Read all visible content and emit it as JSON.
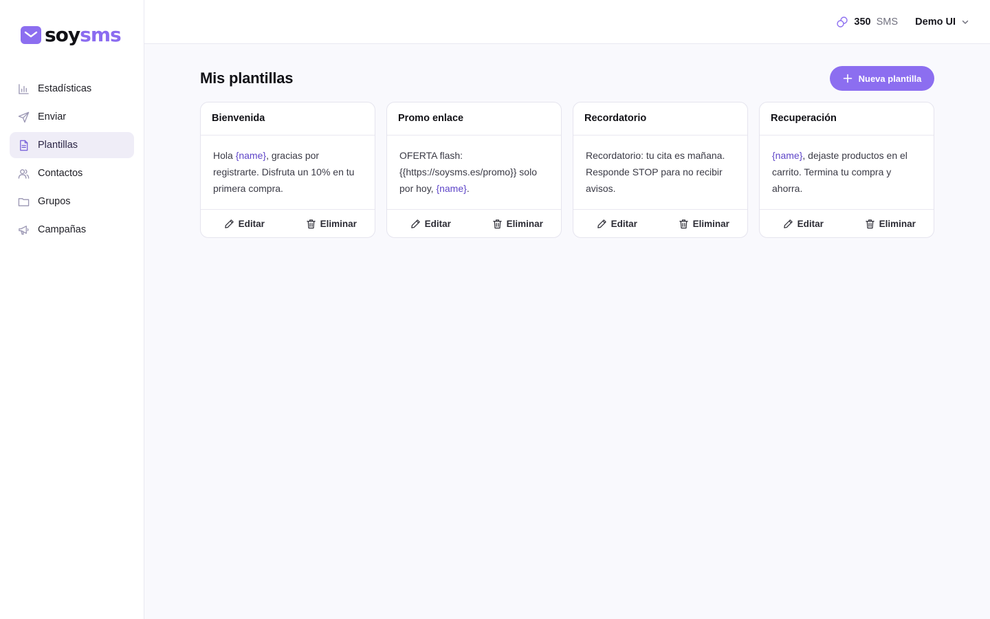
{
  "brand": {
    "name_part1": "soy",
    "name_part2": "sms",
    "accent": "#8c6ef0"
  },
  "sidebar": {
    "items": [
      {
        "label": "Estadísticas",
        "icon": "bar-chart-icon",
        "active": false
      },
      {
        "label": "Enviar",
        "icon": "send-icon",
        "active": false
      },
      {
        "label": "Plantillas",
        "icon": "document-icon",
        "active": true
      },
      {
        "label": "Contactos",
        "icon": "users-icon",
        "active": false
      },
      {
        "label": "Grupos",
        "icon": "folder-icon",
        "active": false
      },
      {
        "label": "Campañas",
        "icon": "megaphone-icon",
        "active": false
      }
    ]
  },
  "topbar": {
    "credits_icon": "coins-icon",
    "credits_count": "350",
    "credits_unit": "SMS",
    "user_name": "Demo UI"
  },
  "main": {
    "title": "Mis plantillas",
    "new_button_label": "Nueva plantilla"
  },
  "templates": [
    {
      "title": "Bienvenida",
      "body": [
        {
          "text": "Hola ",
          "var": false
        },
        {
          "text": "{name}",
          "var": true
        },
        {
          "text": ", gracias por registrarte. Disfruta un 10% en tu primera compra.",
          "var": false
        }
      ]
    },
    {
      "title": "Promo enlace",
      "body": [
        {
          "text": "OFERTA flash: {{https://soysms.es/promo}} solo por hoy, ",
          "var": false
        },
        {
          "text": "{name}",
          "var": true
        },
        {
          "text": ".",
          "var": false
        }
      ]
    },
    {
      "title": "Recordatorio",
      "body": [
        {
          "text": "Recordatorio: tu cita es mañana. Responde STOP para no recibir avisos.",
          "var": false
        }
      ]
    },
    {
      "title": "Recuperación",
      "body": [
        {
          "text": "{name}",
          "var": true
        },
        {
          "text": ", dejaste productos en el carrito. Termina tu compra y ahorra.",
          "var": false
        }
      ]
    }
  ],
  "card_actions": {
    "edit_label": "Editar",
    "delete_label": "Eliminar"
  }
}
